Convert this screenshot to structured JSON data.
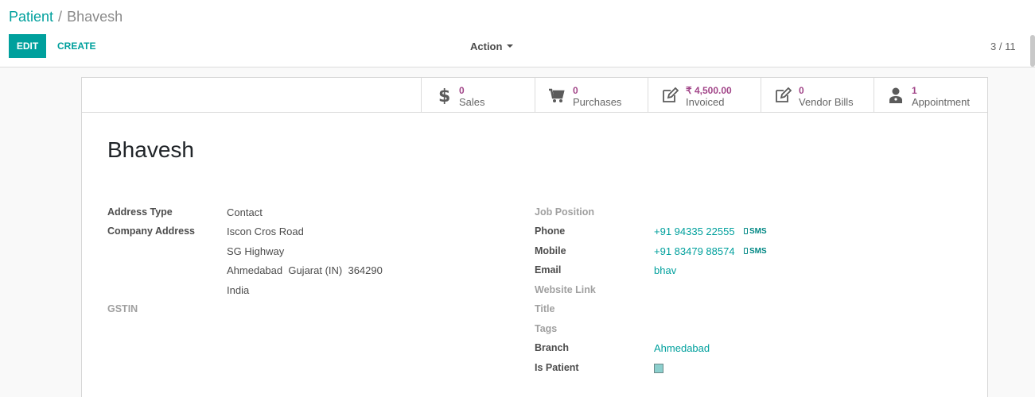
{
  "breadcrumb": {
    "parent": "Patient",
    "separator": "/",
    "current": "Bhavesh"
  },
  "toolbar": {
    "edit_label": "EDIT",
    "create_label": "CREATE",
    "action_label": "Action",
    "pager": "3 / 11"
  },
  "smart_buttons": [
    {
      "icon": "dollar-icon",
      "value": "0",
      "label": "Sales"
    },
    {
      "icon": "cart-icon",
      "value": "0",
      "label": "Purchases"
    },
    {
      "icon": "edit-icon",
      "value": "₹ 4,500.00",
      "label": "Invoiced"
    },
    {
      "icon": "edit-icon",
      "value": "0",
      "label": "Vendor Bills"
    },
    {
      "icon": "doctor-icon",
      "value": "1",
      "label": "Appointment"
    }
  ],
  "record": {
    "name": "Bhavesh",
    "left": {
      "address_type_label": "Address Type",
      "address_type": "Contact",
      "company_address_label": "Company Address",
      "street": "Iscon Cros Road",
      "street2": "SG Highway",
      "city_line": "Ahmedabad  Gujarat (IN)  364290",
      "country": "India",
      "gstin_label": "GSTIN"
    },
    "right": {
      "job_position_label": "Job Position",
      "phone_label": "Phone",
      "phone": "+91 94335 22555",
      "mobile_label": "Mobile",
      "mobile": "+91 83479 88574",
      "sms_label": "SMS",
      "email_label": "Email",
      "email": "bhav",
      "website_label": "Website Link",
      "title_label": "Title",
      "tags_label": "Tags",
      "branch_label": "Branch",
      "branch": "Ahmedabad",
      "is_patient_label": "Is Patient",
      "is_patient": true
    }
  },
  "colors": {
    "accent": "#00a09d",
    "smart_value": "#a24689"
  }
}
